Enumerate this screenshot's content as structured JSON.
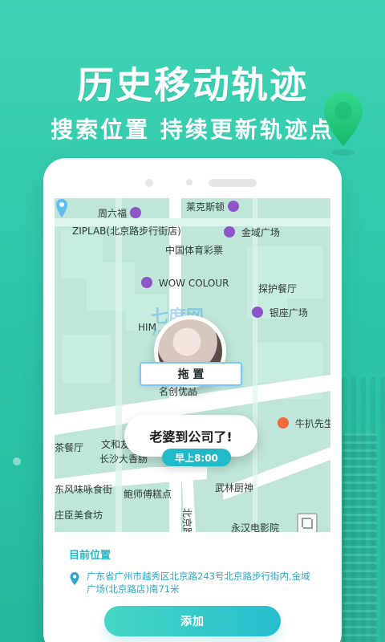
{
  "hero": {
    "title": "历史移动轨迹",
    "subtitle": "搜索位置 持续更新轨迹点"
  },
  "map": {
    "watermark_top": "七度网",
    "watermark_bottom": "7do.net",
    "labels": [
      {
        "name": "poi-zhouliufu",
        "text": "周六福",
        "icon": "shopping-bag-icon"
      },
      {
        "name": "poi-laikesidun",
        "text": "莱克斯顿",
        "icon": "shopping-bag-icon"
      },
      {
        "name": "poi-ziplab",
        "text": "ZIPLAB(北京路步行街店)",
        "icon": "shopping-bag-icon"
      },
      {
        "name": "poi-jinyu-guangchang",
        "text": "金域广场",
        "icon": "shopping-bag-icon"
      },
      {
        "name": "poi-zhongguo-tiyu-caipiao",
        "text": "中国体育彩票",
        "icon": "none"
      },
      {
        "name": "poi-wow-colour",
        "text": "WOW COLOUR",
        "icon": "shopping-bag-icon"
      },
      {
        "name": "poi-tanhu-canting",
        "text": "探护餐厅",
        "icon": "none"
      },
      {
        "name": "poi-yinzuo-guangchang",
        "text": "银座广场",
        "icon": "shopping-bag-icon"
      },
      {
        "name": "poi-him",
        "text": "HIM",
        "icon": "none"
      },
      {
        "name": "poi-mingchuangyoupin",
        "text": "名创优品",
        "icon": "none"
      },
      {
        "name": "poi-niu-pa-xiansheng",
        "text": "牛扒先生",
        "icon": "restaurant-icon"
      },
      {
        "name": "poi-wenhe",
        "text": "文和友",
        "icon": "none"
      },
      {
        "name": "poi-changsha-daxiang",
        "text": "长沙大香肠",
        "icon": "none"
      },
      {
        "name": "poi-cha-canting",
        "text": "茶餐厅",
        "icon": "none"
      },
      {
        "name": "poi-dongfeng-weishishi",
        "text": "东风味咏食街",
        "icon": "none"
      },
      {
        "name": "poi-baoshi-fuzhandian",
        "text": "鲍师傅糕点",
        "icon": "none"
      },
      {
        "name": "poi-wulinchufang",
        "text": "武林厨神",
        "icon": "none"
      },
      {
        "name": "poi-zhuangchen-meishifang",
        "text": "庄臣美食坊",
        "icon": "none"
      },
      {
        "name": "poi-yonghan-dianyingyuan",
        "text": "永汉电影院",
        "icon": "none"
      },
      {
        "name": "road-beijinglu",
        "text": "北京路",
        "icon": "none"
      }
    ],
    "avatar_alt": "profile photo",
    "chip_label": "拖  置",
    "bubble_text": "老婆到公司了!",
    "time_tag": "早上8:00"
  },
  "panel": {
    "title": "目前位置",
    "address": "广东省广州市越秀区北京路243号北京路步行街内,金域广场(北京路店)南71米",
    "add_button": "添加"
  },
  "colors": {
    "bg_top": "#3fd3b4",
    "bg_bottom": "#24b79b",
    "map_water": "#bfe6d8",
    "road": "#ffffff",
    "accent_teal": "#25b7c6",
    "poi_purple": "#8e55c8",
    "poi_orange": "#f06a3b"
  }
}
